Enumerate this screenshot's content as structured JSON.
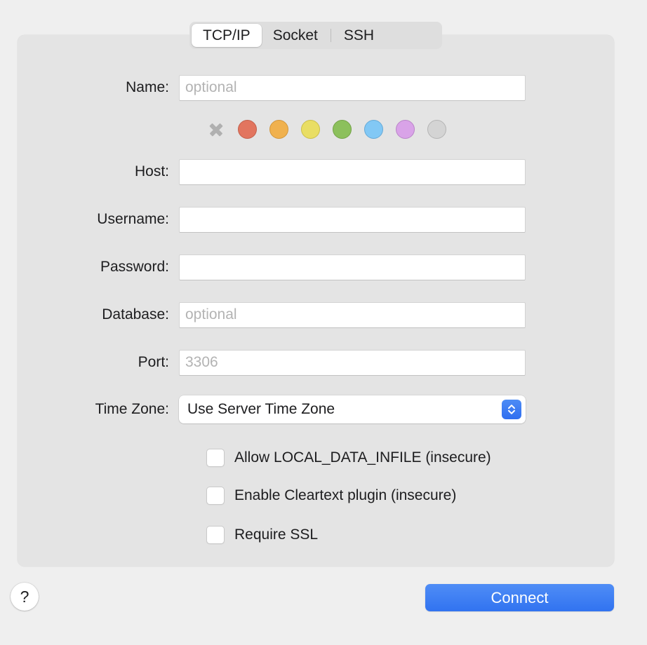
{
  "tabs": {
    "items": [
      {
        "label": "TCP/IP",
        "active": true
      },
      {
        "label": "Socket",
        "active": false
      },
      {
        "label": "SSH",
        "active": false
      }
    ]
  },
  "form": {
    "name": {
      "label": "Name:",
      "value": "",
      "placeholder": "optional"
    },
    "host": {
      "label": "Host:",
      "value": "",
      "placeholder": ""
    },
    "username": {
      "label": "Username:",
      "value": "",
      "placeholder": ""
    },
    "password": {
      "label": "Password:",
      "value": "",
      "placeholder": ""
    },
    "database": {
      "label": "Database:",
      "value": "",
      "placeholder": "optional"
    },
    "port": {
      "label": "Port:",
      "value": "",
      "placeholder": "3306"
    },
    "timezone": {
      "label": "Time Zone:",
      "value": "Use Server Time Zone"
    }
  },
  "color_swatches": {
    "items": [
      {
        "name": "none",
        "color": "none",
        "selected": false
      },
      {
        "name": "red",
        "color": "#e2755f",
        "selected": false
      },
      {
        "name": "orange",
        "color": "#f0b14e",
        "selected": false
      },
      {
        "name": "yellow",
        "color": "#e9de64",
        "selected": false
      },
      {
        "name": "green",
        "color": "#8cc05c",
        "selected": false
      },
      {
        "name": "blue",
        "color": "#82c8f5",
        "selected": false
      },
      {
        "name": "purple",
        "color": "#d9a3e8",
        "selected": false
      },
      {
        "name": "gray",
        "color": "#d4d4d4",
        "selected": false
      }
    ]
  },
  "checkboxes": {
    "items": [
      {
        "label": "Allow LOCAL_DATA_INFILE (insecure)",
        "checked": false
      },
      {
        "label": "Enable Cleartext plugin (insecure)",
        "checked": false
      },
      {
        "label": "Require SSL",
        "checked": false
      }
    ]
  },
  "footer": {
    "help_label": "?",
    "connect_label": "Connect"
  },
  "colors": {
    "window_background": "#efefef",
    "panel_background": "#e4e4e4",
    "accent_blue": "#3173f0",
    "tabbar_background": "#dedede",
    "text": "#1d1d1f",
    "placeholder_text": "#b3b3b3"
  }
}
